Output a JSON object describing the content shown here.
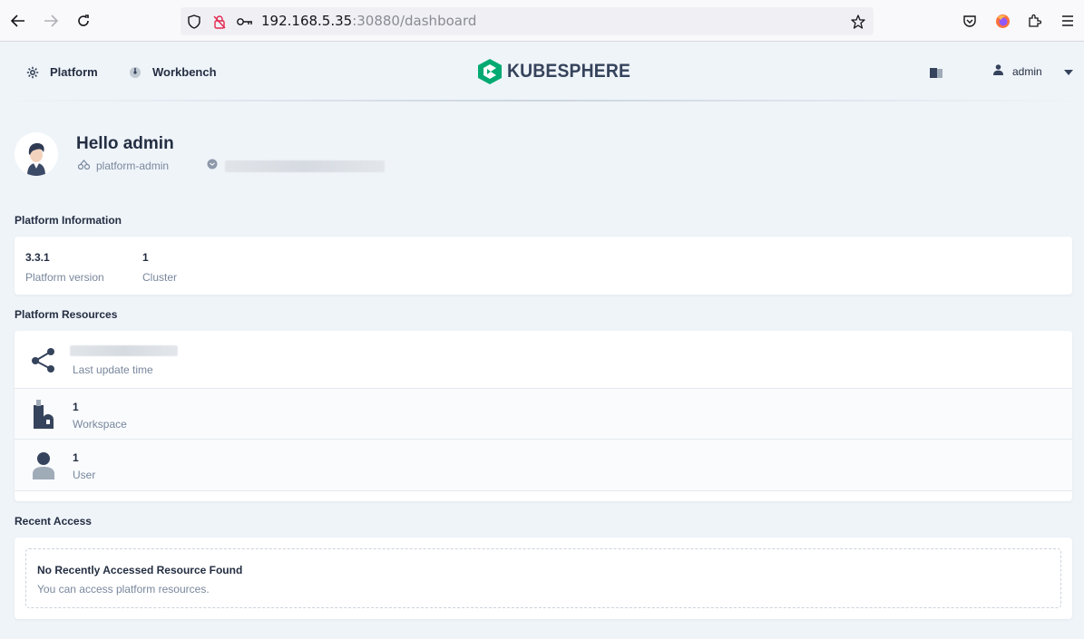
{
  "browser": {
    "url_host": "192.168.5.35",
    "url_rest": ":30880/dashboard",
    "icons": [
      "back-arrow-icon",
      "forward-arrow-icon",
      "reload-icon",
      "shield-icon",
      "permissions-blocked-icon",
      "key-icon",
      "bookmark-star-icon",
      "pocket-icon",
      "firefox-icon",
      "extensions-icon",
      "menu-icon"
    ]
  },
  "header": {
    "nav": [
      {
        "label": "Platform",
        "icon": "gear-icon"
      },
      {
        "label": "Workbench",
        "icon": "dashboard-icon"
      }
    ],
    "logo_text": "KUBESPHERE",
    "brand_color": "#00aa72",
    "user_name": "admin"
  },
  "hero": {
    "greeting": "Hello admin",
    "role": "platform-admin"
  },
  "platform_info": {
    "title": "Platform Information",
    "items": [
      {
        "value": "3.3.1",
        "label": "Platform version"
      },
      {
        "value": "1",
        "label": "Cluster"
      }
    ]
  },
  "platform_resources": {
    "title": "Platform Resources",
    "rows": [
      {
        "value": "",
        "label": "Last update time",
        "icon": "cluster-nodes-icon"
      },
      {
        "value": "1",
        "label": "Workspace",
        "icon": "workspace-icon"
      },
      {
        "value": "1",
        "label": "User",
        "icon": "user-icon"
      }
    ]
  },
  "recent_access": {
    "title": "Recent Access",
    "empty_title": "No Recently Accessed Resource Found",
    "empty_desc": "You can access platform resources."
  }
}
